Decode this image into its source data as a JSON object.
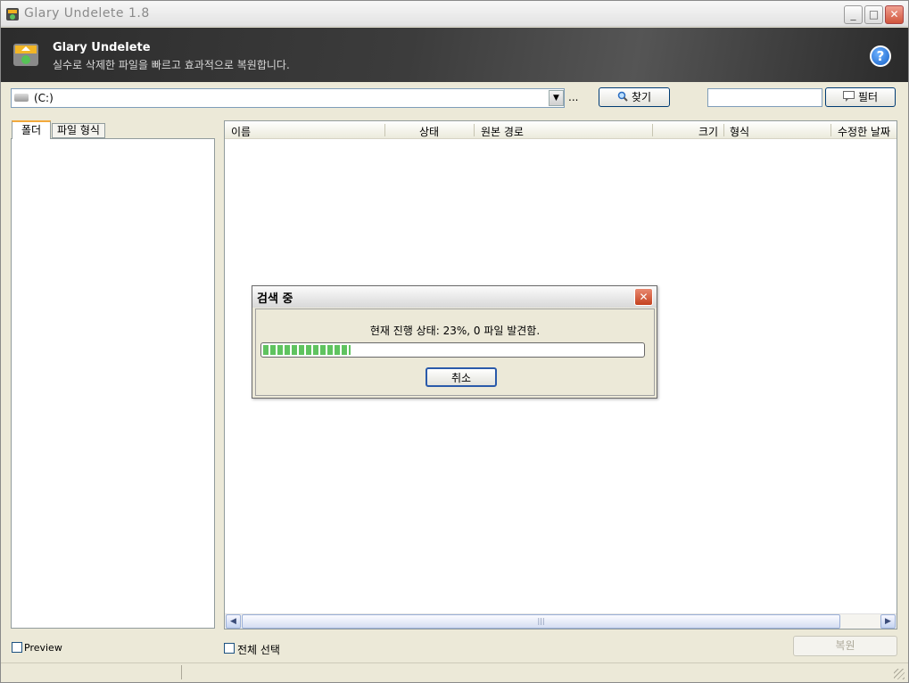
{
  "window": {
    "title": "Glary Undelete 1.8",
    "controls": {
      "minimize": "_",
      "maximize": "□",
      "close": "✕"
    }
  },
  "banner": {
    "title": "Glary Undelete",
    "subtitle": "실수로 삭제한 파일을 빠르고 효과적으로 복원합니다.",
    "help_icon": "?"
  },
  "toolbar": {
    "drive_value": "(C:)",
    "ellipsis": "...",
    "find_label": "찾기",
    "filter_value": "",
    "filter_label": "필터"
  },
  "left_tabs": [
    {
      "label": "폴더",
      "active": true
    },
    {
      "label": "파일 형식",
      "active": false
    }
  ],
  "list": {
    "columns": [
      "이름",
      "상태",
      "원본 경로",
      "크기",
      "형식",
      "수정한 날짜"
    ],
    "rows": []
  },
  "bottom": {
    "preview_label": "Preview",
    "preview_checked": false,
    "select_all_label": "전체 선택",
    "select_all_checked": false,
    "restore_label": "복원",
    "restore_enabled": false
  },
  "dialog": {
    "title": "검색 중",
    "status": "현재 진행 상태: 23%, 0 파일 발견함.",
    "progress": 0.23,
    "cancel_label": "취소",
    "close_icon": "✕"
  },
  "colors": {
    "accent": "#003c74",
    "progress": "#5fc35f",
    "banner": "#2c2c2c"
  }
}
